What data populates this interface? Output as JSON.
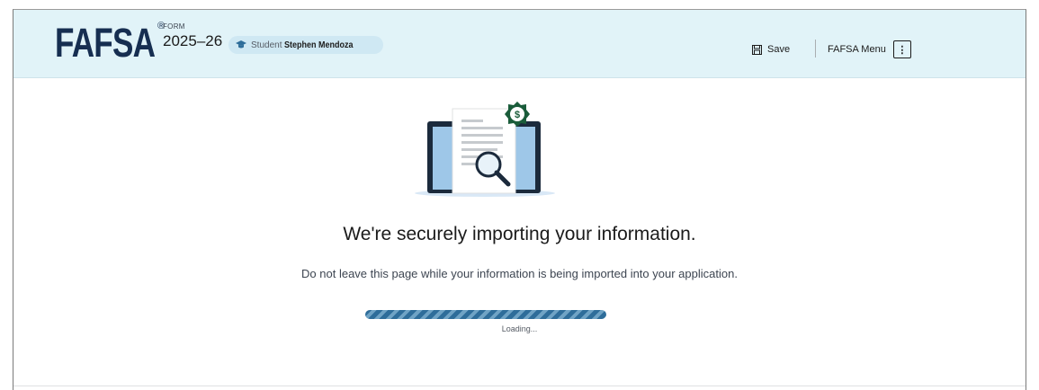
{
  "header": {
    "logo": "FAFSA",
    "logo_mark": "®",
    "form_label": "FORM",
    "form_year": "2025–26",
    "student": {
      "role": "Student",
      "name": "Stephen Mendoza",
      "icon": "graduation-cap-icon"
    },
    "save_label": "Save",
    "save_icon": "save-icon",
    "menu_label": "FAFSA Menu",
    "menu_icon": "vertical-dots-icon"
  },
  "main": {
    "illustration": "laptop-document-magnifier-dollar-illustration",
    "title": "We're securely importing your information.",
    "subtitle": "Do not leave this page while your information is being imported into your application.",
    "progress": 1.0,
    "loading_label": "Loading..."
  },
  "colors": {
    "header_bg": "#e1f3f8",
    "navy": "#162e51",
    "progress_dark": "#2e6d9a",
    "progress_light": "#6fa3c5",
    "badge_green": "#1a5c3a"
  }
}
